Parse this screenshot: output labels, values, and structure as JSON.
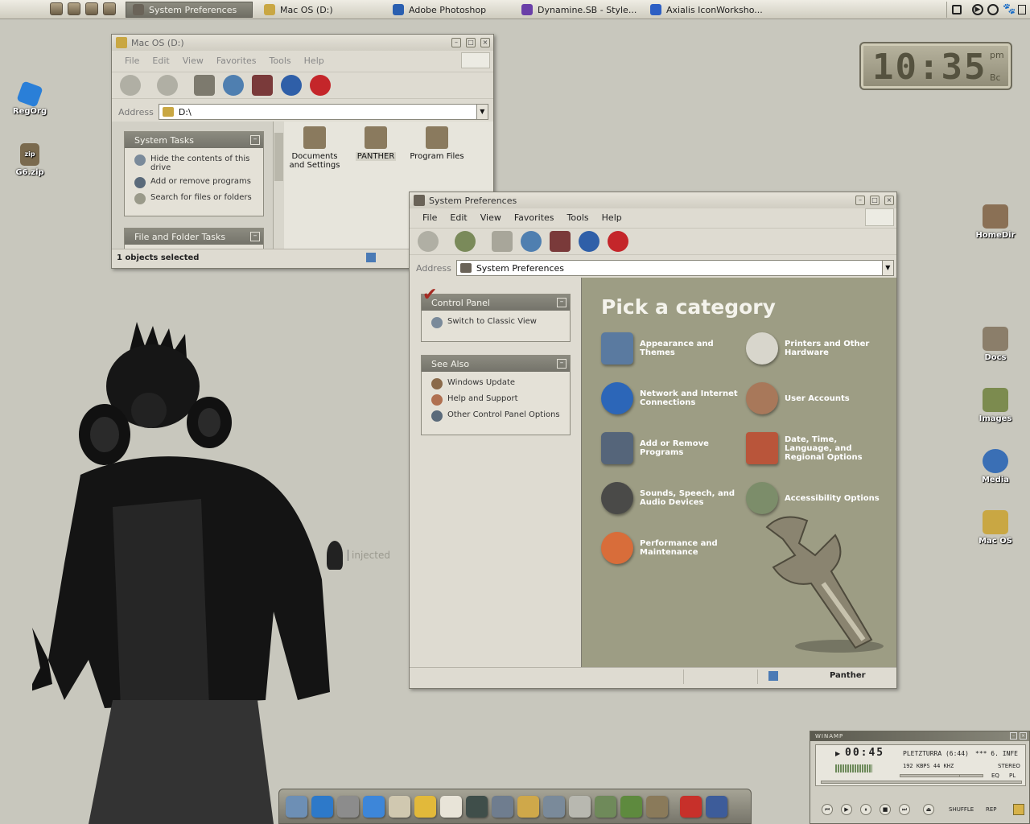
{
  "taskbar": {
    "buttons": [
      {
        "label": "System Preferences",
        "active": true
      },
      {
        "label": "Mac OS (D:)",
        "active": false
      },
      {
        "label": "Adobe Photoshop",
        "active": false
      },
      {
        "label": "Dynamine.SB - Style...",
        "active": false
      },
      {
        "label": "Axialis IconWorksho...",
        "active": false
      }
    ]
  },
  "desktop": {
    "left_icons": [
      {
        "label": "RegOrg",
        "icon": "regorg-icon",
        "color": "#2a7fd8"
      },
      {
        "label": "G6.zip",
        "icon": "zip-icon",
        "color": "#7a6a4e"
      }
    ],
    "right_icons": [
      {
        "label": "HomeDir",
        "icon": "home-icon",
        "color": "#8a7055"
      },
      {
        "label": "Docs",
        "icon": "docs-icon",
        "color": "#8b7e6a"
      },
      {
        "label": "Images",
        "icon": "images-icon",
        "color": "#7c8b4f"
      },
      {
        "label": "Media",
        "icon": "media-icon",
        "color": "#3a6fb5"
      },
      {
        "label": "Mac OS",
        "icon": "drive-icon",
        "color": "#c9a743"
      }
    ],
    "watermark": "injected"
  },
  "clock": {
    "time": "10:35",
    "ampm": "pm",
    "sub": "Bc"
  },
  "mac_window": {
    "title": "Mac OS (D:)",
    "menu": [
      "File",
      "Edit",
      "View",
      "Favorites",
      "Tools",
      "Help"
    ],
    "address_label": "Address",
    "address": "D:\\",
    "system_tasks": {
      "title": "System Tasks",
      "items": [
        "Hide the contents of this drive",
        "Add or remove programs",
        "Search for files or folders"
      ]
    },
    "file_folder_tasks": {
      "title": "File and Folder Tasks"
    },
    "folders": [
      "Documents and Settings",
      "PANTHER",
      "Program Files"
    ],
    "status": "1 objects selected"
  },
  "sysprefs_window": {
    "title": "System Preferences",
    "menu": [
      "File",
      "Edit",
      "View",
      "Favorites",
      "Tools",
      "Help"
    ],
    "address_label": "Address",
    "address": "System Preferences",
    "control_panel": {
      "title": "Control Panel",
      "items": [
        "Switch to Classic View"
      ]
    },
    "see_also": {
      "title": "See Also",
      "items": [
        "Windows Update",
        "Help and Support",
        "Other Control Panel Options"
      ]
    },
    "heading": "Pick a category",
    "categories": [
      {
        "label": "Appearance and Themes",
        "icon": "monitor-icon",
        "color": "#5a7aa0"
      },
      {
        "label": "Printers and Other Hardware",
        "icon": "printer-icon",
        "color": "#d8d6cc"
      },
      {
        "label": "Network and Internet Connections",
        "icon": "globe-icon",
        "color": "#2c66b8"
      },
      {
        "label": "User Accounts",
        "icon": "user-icon",
        "color": "#a8785a"
      },
      {
        "label": "Add or Remove Programs",
        "icon": "installer-icon",
        "color": "#55657a"
      },
      {
        "label": "Date, Time, Language, and Regional Options",
        "icon": "calendar-icon",
        "color": "#b9553a"
      },
      {
        "label": "Sounds, Speech, and Audio Devices",
        "icon": "speaker-icon",
        "color": "#4a4a48"
      },
      {
        "label": "Accessibility Options",
        "icon": "accessibility-icon",
        "color": "#7c8d6a"
      },
      {
        "label": "Performance and Maintenance",
        "icon": "gauge-icon",
        "color": "#d86d3a"
      }
    ],
    "status_right": "Panther"
  },
  "dock": {
    "items": [
      {
        "icon": "finder-icon",
        "color": "#6d8fb5"
      },
      {
        "icon": "internet-explorer-icon",
        "color": "#2d79c9"
      },
      {
        "icon": "mail-icon",
        "color": "#8c8c8c"
      },
      {
        "icon": "chat-icon",
        "color": "#3d86d9"
      },
      {
        "icon": "notes-icon",
        "color": "#d0c8b0"
      },
      {
        "icon": "stickies-icon",
        "color": "#e2b93a"
      },
      {
        "icon": "textedit-icon",
        "color": "#e8e4d8"
      },
      {
        "icon": "quicktime-icon",
        "color": "#3f4e4a"
      },
      {
        "icon": "preview-icon",
        "color": "#6f7d8f"
      },
      {
        "icon": "pencil-icon",
        "color": "#cfa84a"
      },
      {
        "icon": "tools-icon",
        "color": "#7a8a9a"
      },
      {
        "icon": "disk-utility-icon",
        "color": "#b8b8b0"
      },
      {
        "icon": "installer-icon",
        "color": "#6f8a5a"
      },
      {
        "icon": "bbedit-icon",
        "color": "#5e8a3e"
      },
      {
        "icon": "photo-icon",
        "color": "#8a7a5a"
      },
      {
        "icon": "stop-icon",
        "color": "#c7302a"
      },
      {
        "icon": "shield-icon",
        "color": "#3d5c9a"
      }
    ]
  },
  "winamp": {
    "title": "WINAMP",
    "time": "00:45",
    "track": "PLETZTURRA (6:44)",
    "marquee": "*** 6. INFE",
    "bitrate": "192 KBPS 44 KHZ",
    "stereo": "STEREO",
    "eq": "EQ",
    "pl": "PL",
    "shuffle": "SHUFFLE",
    "rep": "REP"
  }
}
